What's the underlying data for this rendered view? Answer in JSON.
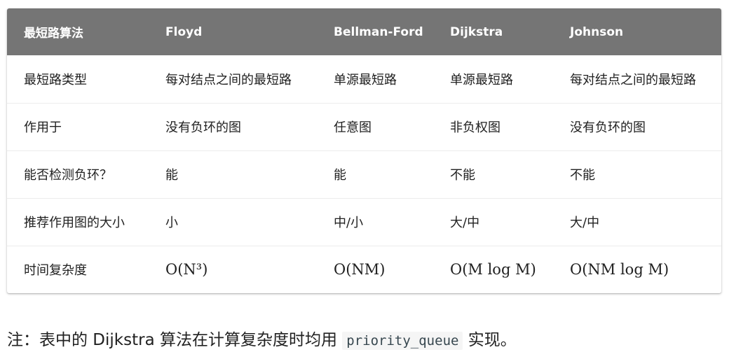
{
  "table": {
    "headers": [
      "最短路算法",
      "Floyd",
      "Bellman-Ford",
      "Dijkstra",
      "Johnson"
    ],
    "rows": [
      [
        "最短路类型",
        "每对结点之间的最短路",
        "单源最短路",
        "单源最短路",
        "每对结点之间的最短路"
      ],
      [
        "作用于",
        "没有负环的图",
        "任意图",
        "非负权图",
        "没有负环的图"
      ],
      [
        "能否检测负环？",
        "能",
        "能",
        "不能",
        "不能"
      ],
      [
        "推荐作用图的大小",
        "小",
        "中/小",
        "大/中",
        "大/中"
      ],
      [
        "时间复杂度",
        "O(N³)",
        "O(NM)",
        "O(M log M)",
        "O(NM log M)"
      ]
    ]
  },
  "note": {
    "prefix": "注：表中的 Dijkstra 算法在计算复杂度时均用",
    "code": "priority_queue",
    "suffix": "实现。"
  },
  "colors": {
    "header_bg": "#757575",
    "header_text": "#ffffff",
    "row_divider": "#ececec"
  }
}
